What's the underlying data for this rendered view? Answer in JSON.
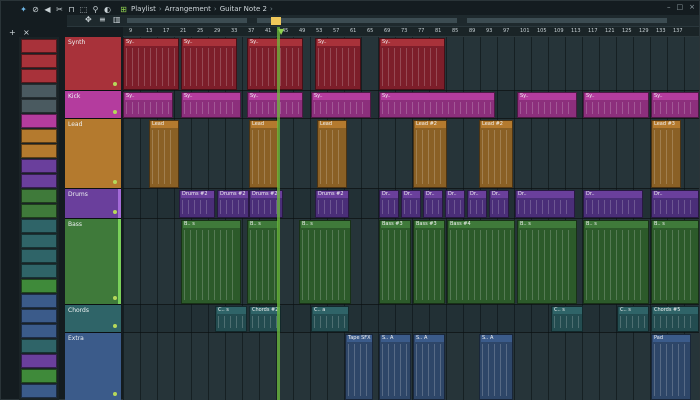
{
  "toolbar": {
    "icons": [
      "wand-icon",
      "mute-icon",
      "speaker-icon",
      "cut-icon",
      "magnet-icon",
      "select-icon",
      "zoom-icon",
      "volume-icon"
    ],
    "breadcrumb": [
      "Playlist",
      "Arrangement",
      "Guitar Note 2"
    ],
    "separator": "›",
    "end_arrow": "›",
    "window_controls": [
      "–",
      "□",
      "×"
    ]
  },
  "strip": {
    "plus_label": "+",
    "close_label": "×"
  },
  "ruler": {
    "ticks": [
      "9",
      "13",
      "17",
      "21",
      "25",
      "29",
      "33",
      "37",
      "41",
      "45",
      "49",
      "53",
      "57",
      "61",
      "65",
      "69",
      "73",
      "77",
      "81",
      "85",
      "89",
      "93",
      "97",
      "101",
      "105",
      "109",
      "113",
      "117",
      "121",
      "125",
      "129",
      "133",
      "137"
    ]
  },
  "tracks": [
    {
      "name": "Synth",
      "color": "#a8323a",
      "clip_color": "#7d1e2a"
    },
    {
      "name": "Kick",
      "color": "#b43c9e",
      "clip_color": "#8c2f7c"
    },
    {
      "name": "Lead",
      "color": "#b47a2e",
      "clip_color": "#8a6025"
    },
    {
      "name": "Drums",
      "color": "#6a3f9c",
      "clip_color": "#4a2e78"
    },
    {
      "name": "Bass",
      "color": "#3f7a3a",
      "clip_color": "#2c5a2a"
    },
    {
      "name": "Chords",
      "color": "#2f6468",
      "clip_color": "#234c50"
    },
    {
      "name": "Extra",
      "color": "#3b5b8a",
      "clip_color": "#2e4668"
    }
  ],
  "clips": {
    "synth": "Sy..",
    "synth_alt": "Sy..",
    "lead": "Lead",
    "lead2": "Lead #2",
    "lead3": "Lead #3",
    "drums2": "Drums #2",
    "drums_short": "Dr..",
    "bass_short": "B.. s",
    "bass3": "Bass #3",
    "bass4": "Bass #4",
    "chords_short": "C.. s",
    "chords2": "Chords #2",
    "chords_short2": "C.. a",
    "chords5": "Chords #5",
    "tape": "Tape SFX",
    "sa": "S.. A",
    "pad": "Pad"
  }
}
